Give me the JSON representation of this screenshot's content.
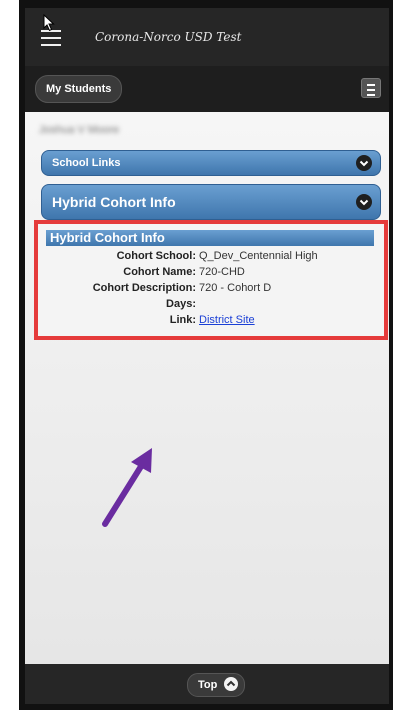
{
  "header": {
    "title": "Corona-Norco USD Test"
  },
  "toolbar": {
    "my_students_label": "My Students"
  },
  "student": {
    "name": "Joshua V Moore"
  },
  "sections": {
    "school_links": "School Links",
    "hybrid_cohort": "Hybrid Cohort Info"
  },
  "panel": {
    "title": "Hybrid Cohort Info",
    "rows": [
      {
        "key": "Cohort School:",
        "value": "Q_Dev_Centennial High"
      },
      {
        "key": "Cohort Name:",
        "value": "720-CHD"
      },
      {
        "key": "Cohort Description:",
        "value": "720 - Cohort D"
      },
      {
        "key": "Days:",
        "value": ""
      },
      {
        "key": "Link:",
        "value": "District Site"
      }
    ]
  },
  "footer": {
    "top_label": "Top"
  },
  "colors": {
    "accent_blue": "#4f86bd",
    "highlight_red": "#e53b3b",
    "arrow_purple": "#6a2ca0"
  },
  "icons": [
    "hamburger-menu-icon",
    "menu-icon",
    "chevron-down-icon",
    "chevron-up-icon",
    "mouse-cursor-icon",
    "annotation-arrow"
  ]
}
